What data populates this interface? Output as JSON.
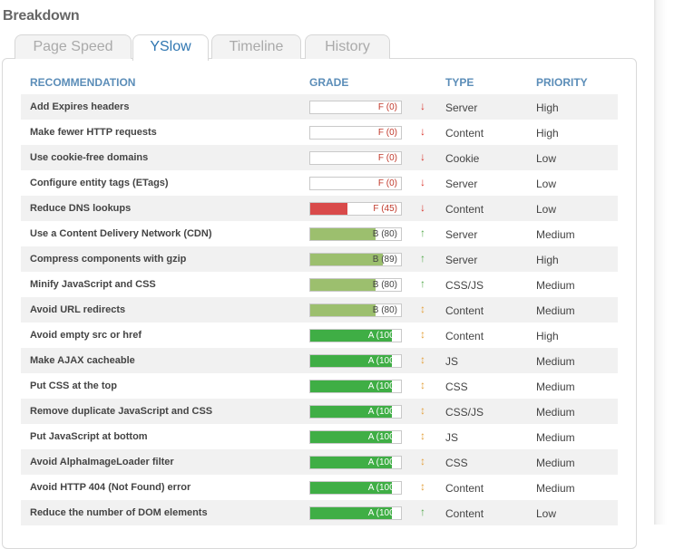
{
  "title": "Breakdown",
  "tabs": [
    {
      "label": "Page Speed",
      "active": false
    },
    {
      "label": "YSlow",
      "active": true
    },
    {
      "label": "Timeline",
      "active": false
    },
    {
      "label": "History",
      "active": false
    }
  ],
  "columns": {
    "recommendation": "RECOMMENDATION",
    "grade": "GRADE",
    "type": "TYPE",
    "priority": "PRIORITY"
  },
  "colors": {
    "fail": "#d94a4a",
    "b_grade": "#9cbf6e",
    "a_grade": "#3fae45",
    "trend_down": "#d9342b",
    "trend_up": "#53a84b",
    "trend_same": "#e3a03c"
  },
  "rows": [
    {
      "recommendation": "Add Expires headers",
      "grade": "F (0)",
      "score": 0,
      "trend": "down",
      "trend_icon": "↓",
      "type": "Server",
      "priority": "High"
    },
    {
      "recommendation": "Make fewer HTTP requests",
      "grade": "F (0)",
      "score": 0,
      "trend": "down",
      "trend_icon": "↓",
      "type": "Content",
      "priority": "High"
    },
    {
      "recommendation": "Use cookie-free domains",
      "grade": "F (0)",
      "score": 0,
      "trend": "down",
      "trend_icon": "↓",
      "type": "Cookie",
      "priority": "Low"
    },
    {
      "recommendation": "Configure entity tags (ETags)",
      "grade": "F (0)",
      "score": 0,
      "trend": "down",
      "trend_icon": "↓",
      "type": "Server",
      "priority": "Low"
    },
    {
      "recommendation": "Reduce DNS lookups",
      "grade": "F (45)",
      "score": 45,
      "trend": "down",
      "trend_icon": "↓",
      "type": "Content",
      "priority": "Low"
    },
    {
      "recommendation": "Use a Content Delivery Network (CDN)",
      "grade": "B (80)",
      "score": 80,
      "trend": "up",
      "trend_icon": "↑",
      "type": "Server",
      "priority": "Medium"
    },
    {
      "recommendation": "Compress components with gzip",
      "grade": "B (89)",
      "score": 89,
      "trend": "up",
      "trend_icon": "↑",
      "type": "Server",
      "priority": "High"
    },
    {
      "recommendation": "Minify JavaScript and CSS",
      "grade": "B (80)",
      "score": 80,
      "trend": "up",
      "trend_icon": "↑",
      "type": "CSS/JS",
      "priority": "Medium"
    },
    {
      "recommendation": "Avoid URL redirects",
      "grade": "B (80)",
      "score": 80,
      "trend": "same",
      "trend_icon": "↕",
      "type": "Content",
      "priority": "Medium"
    },
    {
      "recommendation": "Avoid empty src or href",
      "grade": "A (100)",
      "score": 100,
      "trend": "same",
      "trend_icon": "↕",
      "type": "Content",
      "priority": "High"
    },
    {
      "recommendation": "Make AJAX cacheable",
      "grade": "A (100)",
      "score": 100,
      "trend": "same",
      "trend_icon": "↕",
      "type": "JS",
      "priority": "Medium"
    },
    {
      "recommendation": "Put CSS at the top",
      "grade": "A (100)",
      "score": 100,
      "trend": "same",
      "trend_icon": "↕",
      "type": "CSS",
      "priority": "Medium"
    },
    {
      "recommendation": "Remove duplicate JavaScript and CSS",
      "grade": "A (100)",
      "score": 100,
      "trend": "same",
      "trend_icon": "↕",
      "type": "CSS/JS",
      "priority": "Medium"
    },
    {
      "recommendation": "Put JavaScript at bottom",
      "grade": "A (100)",
      "score": 100,
      "trend": "same",
      "trend_icon": "↕",
      "type": "JS",
      "priority": "Medium"
    },
    {
      "recommendation": "Avoid AlphaImageLoader filter",
      "grade": "A (100)",
      "score": 100,
      "trend": "same",
      "trend_icon": "↕",
      "type": "CSS",
      "priority": "Medium"
    },
    {
      "recommendation": "Avoid HTTP 404 (Not Found) error",
      "grade": "A (100)",
      "score": 100,
      "trend": "same",
      "trend_icon": "↕",
      "type": "Content",
      "priority": "Medium"
    },
    {
      "recommendation": "Reduce the number of DOM elements",
      "grade": "A (100)",
      "score": 100,
      "trend": "up",
      "trend_icon": "↑",
      "type": "Content",
      "priority": "Low"
    }
  ]
}
